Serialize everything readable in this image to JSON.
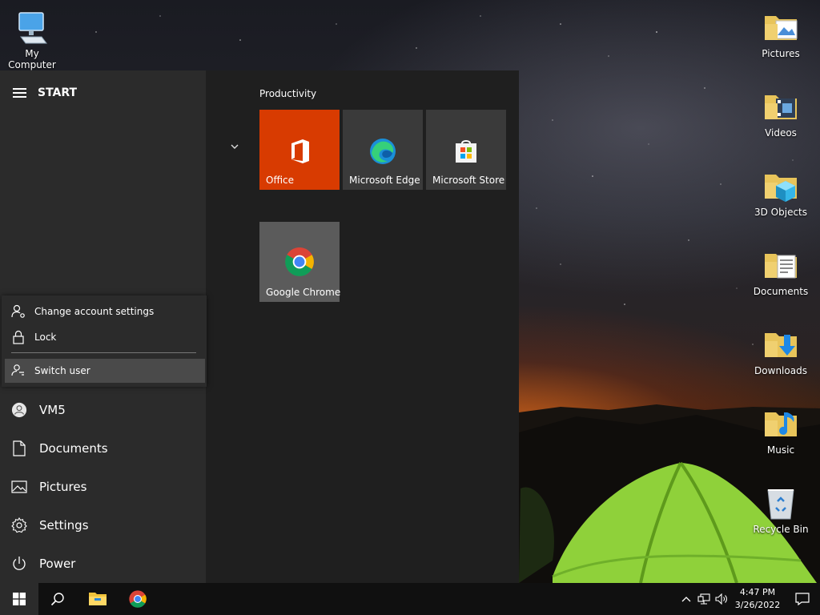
{
  "desktop": {
    "icons": [
      {
        "label": "My Computer",
        "icon": "computer-icon"
      },
      {
        "label": "Pictures",
        "icon": "pictures-folder-icon"
      },
      {
        "label": "Videos",
        "icon": "videos-folder-icon"
      },
      {
        "label": "3D Objects",
        "icon": "3d-objects-folder-icon"
      },
      {
        "label": "Documents",
        "icon": "documents-folder-icon"
      },
      {
        "label": "Downloads",
        "icon": "downloads-folder-icon"
      },
      {
        "label": "Music",
        "icon": "music-folder-icon"
      },
      {
        "label": "Recycle Bin",
        "icon": "recycle-bin-icon"
      }
    ]
  },
  "start": {
    "title": "START",
    "group_title": "Productivity",
    "tiles": [
      {
        "label": "Office",
        "color": "#d83b01"
      },
      {
        "label": "Microsoft Edge",
        "color": "#3a3a3a"
      },
      {
        "label": "Microsoft Store",
        "color": "#3a3a3a"
      },
      {
        "label": "Google Chrome",
        "color": "#5b5b5b"
      }
    ],
    "account_flyout": [
      {
        "label": "Change account settings"
      },
      {
        "label": "Lock"
      },
      {
        "label": "Switch user"
      }
    ],
    "nav": [
      {
        "label": "VM5"
      },
      {
        "label": "Documents"
      },
      {
        "label": "Pictures"
      },
      {
        "label": "Settings"
      },
      {
        "label": "Power"
      }
    ]
  },
  "taskbar": {
    "time": "4:47 PM",
    "date": "3/26/2022"
  },
  "colors": {
    "office": "#d83b01",
    "taskbar": "#101010",
    "menu_left": "#2b2b2b",
    "menu_right": "#1f1f1f"
  }
}
